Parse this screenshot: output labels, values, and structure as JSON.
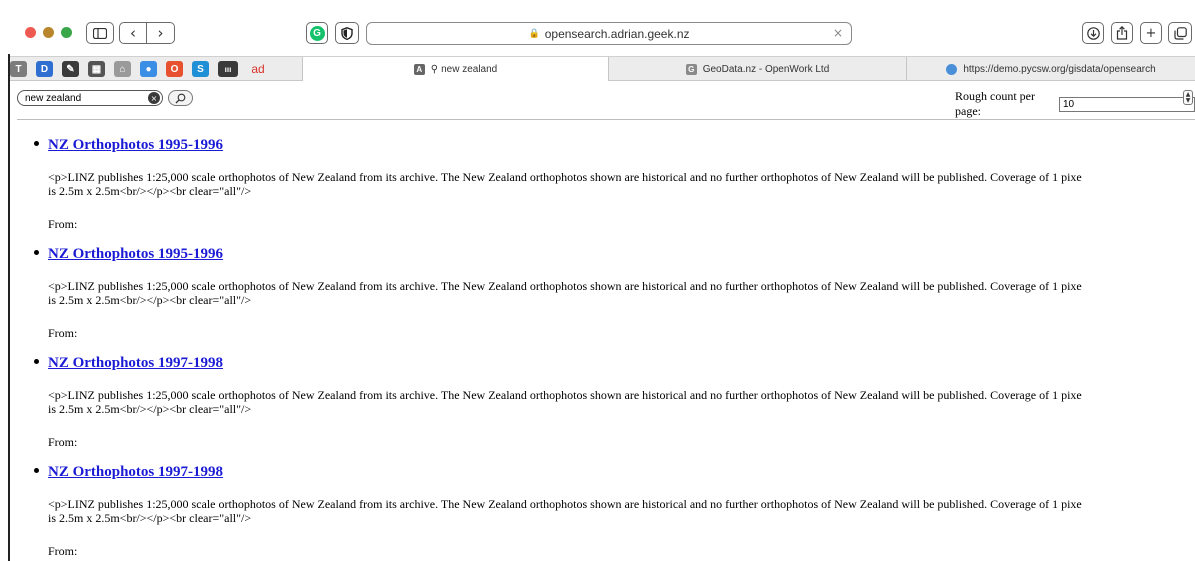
{
  "window": {
    "address": "opensearch.adrian.geek.nz",
    "nav_back": "‹",
    "nav_forward": "›"
  },
  "favorites": [
    {
      "name": "fav-1",
      "glyph": "T",
      "color": "#7c7c7c"
    },
    {
      "name": "fav-2",
      "glyph": "D",
      "color": "#2f6fd1"
    },
    {
      "name": "fav-3",
      "glyph": "✎",
      "color": "#3b3b3b"
    },
    {
      "name": "fav-4",
      "glyph": "▦",
      "color": "#555555"
    },
    {
      "name": "fav-5",
      "glyph": "⌂",
      "color": "#9a9a9a"
    },
    {
      "name": "fav-6",
      "glyph": "●",
      "color": "#3a8ee6"
    },
    {
      "name": "fav-7",
      "glyph": "O",
      "color": "#e8512f"
    },
    {
      "name": "fav-8",
      "glyph": "S",
      "color": "#1f8fd6"
    },
    {
      "name": "fav-9",
      "glyph": "ııı",
      "color": "#3a3a3a"
    },
    {
      "name": "fav-10",
      "glyph": "ad",
      "color": "#d9332a"
    }
  ],
  "tabs": [
    {
      "label": "new zealand",
      "icon": "A",
      "active": true
    },
    {
      "label": "GeoData.nz - OpenWork Ltd",
      "icon": "G",
      "active": false
    },
    {
      "label": "https://demo.pycsw.org/gisdata/opensearch",
      "icon": "●",
      "active": false
    }
  ],
  "search": {
    "value": "new zealand"
  },
  "count": {
    "label": "Rough count per page:",
    "value": "10"
  },
  "results": [
    {
      "title": "NZ Orthophotos 1995-1996",
      "desc_line1": "<p>LINZ publishes 1:25,000 scale orthophotos of New Zealand from its archive. The New Zealand orthophotos shown are historical and no further orthophotos of New Zealand will be published. Coverage of 1 pixe",
      "desc_line2": "is 2.5m x 2.5m<br/></p><br clear=\"all\"/>",
      "from": "From:"
    },
    {
      "title": "NZ Orthophotos 1995-1996",
      "desc_line1": "<p>LINZ publishes 1:25,000 scale orthophotos of New Zealand from its archive. The New Zealand orthophotos shown are historical and no further orthophotos of New Zealand will be published. Coverage of 1 pixe",
      "desc_line2": "is 2.5m x 2.5m<br/></p><br clear=\"all\"/>",
      "from": "From:"
    },
    {
      "title": "NZ Orthophotos 1997-1998",
      "desc_line1": "<p>LINZ publishes 1:25,000 scale orthophotos of New Zealand from its archive. The New Zealand orthophotos shown are historical and no further orthophotos of New Zealand will be published. Coverage of 1 pixe",
      "desc_line2": "is 2.5m x 2.5m<br/></p><br clear=\"all\"/>",
      "from": "From:"
    },
    {
      "title": "NZ Orthophotos 1997-1998",
      "desc_line1": "<p>LINZ publishes 1:25,000 scale orthophotos of New Zealand from its archive. The New Zealand orthophotos shown are historical and no further orthophotos of New Zealand will be published. Coverage of 1 pixe",
      "desc_line2": "is 2.5m x 2.5m<br/></p><br clear=\"all\"/>",
      "from": "From:"
    }
  ]
}
